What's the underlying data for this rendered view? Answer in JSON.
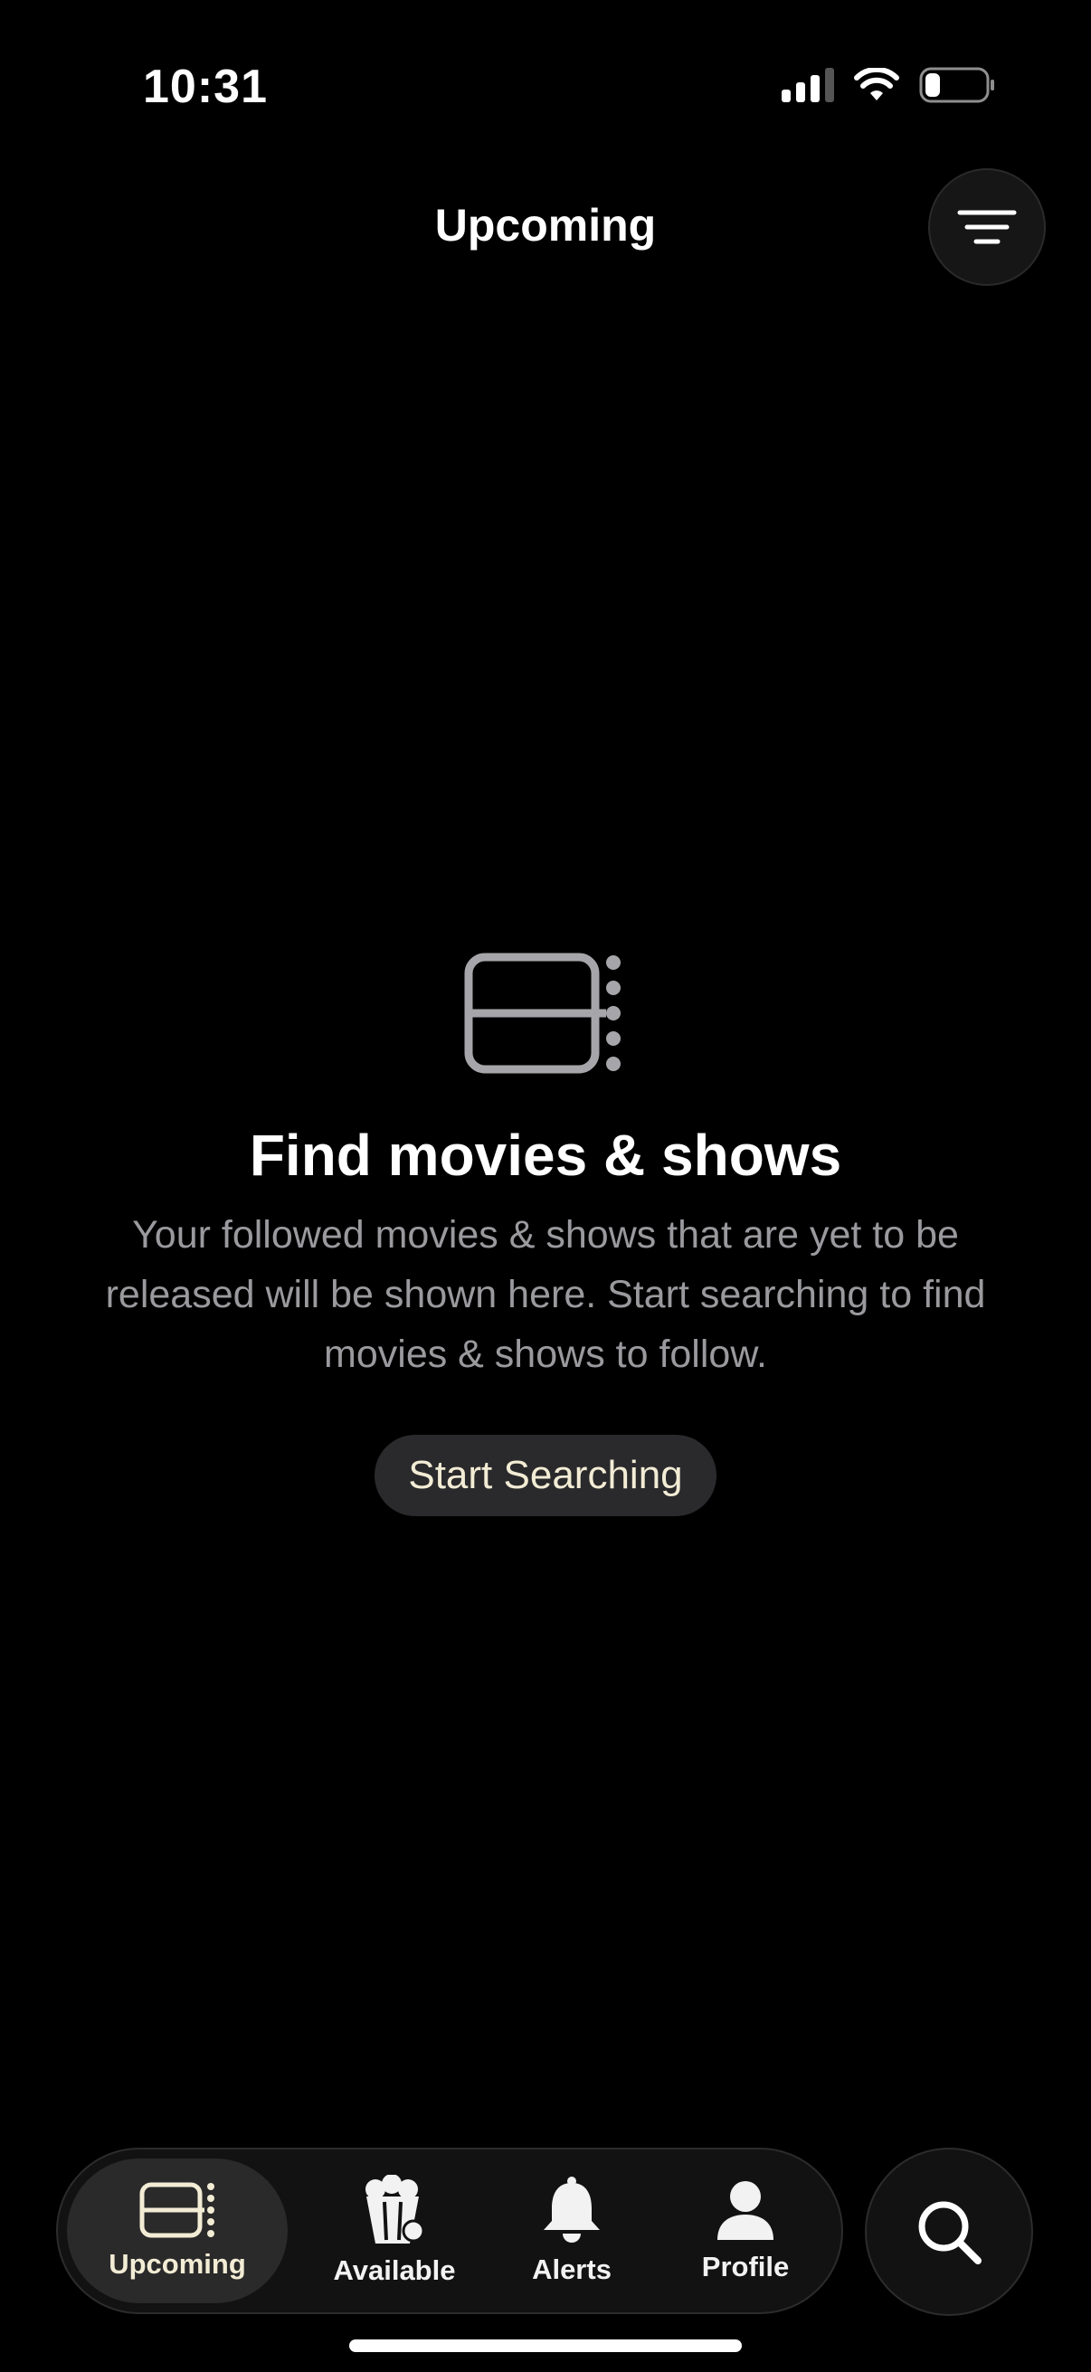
{
  "status_bar": {
    "time": "10:31",
    "battery_level": 0.25
  },
  "header": {
    "title": "Upcoming",
    "filter_icon": "filter-lines-icon"
  },
  "empty_state": {
    "icon": "film-strip-icon",
    "title": "Find movies & shows",
    "body": "Your followed movies & shows that are yet to be released will be shown here. Start searching to find movies & shows to follow.",
    "button_label": "Start Searching"
  },
  "tabbar": {
    "tabs": [
      {
        "label": "Upcoming",
        "icon": "film-strip-icon",
        "active": true
      },
      {
        "label": "Available",
        "icon": "popcorn-icon",
        "active": false
      },
      {
        "label": "Alerts",
        "icon": "bell-icon",
        "active": false
      },
      {
        "label": "Profile",
        "icon": "person-icon",
        "active": false
      }
    ],
    "search_icon": "search-icon"
  },
  "colors": {
    "background": "#000000",
    "accent": "#f3ecd5",
    "secondary_text": "#9a9a9e",
    "surface": "#2a2a2c"
  }
}
